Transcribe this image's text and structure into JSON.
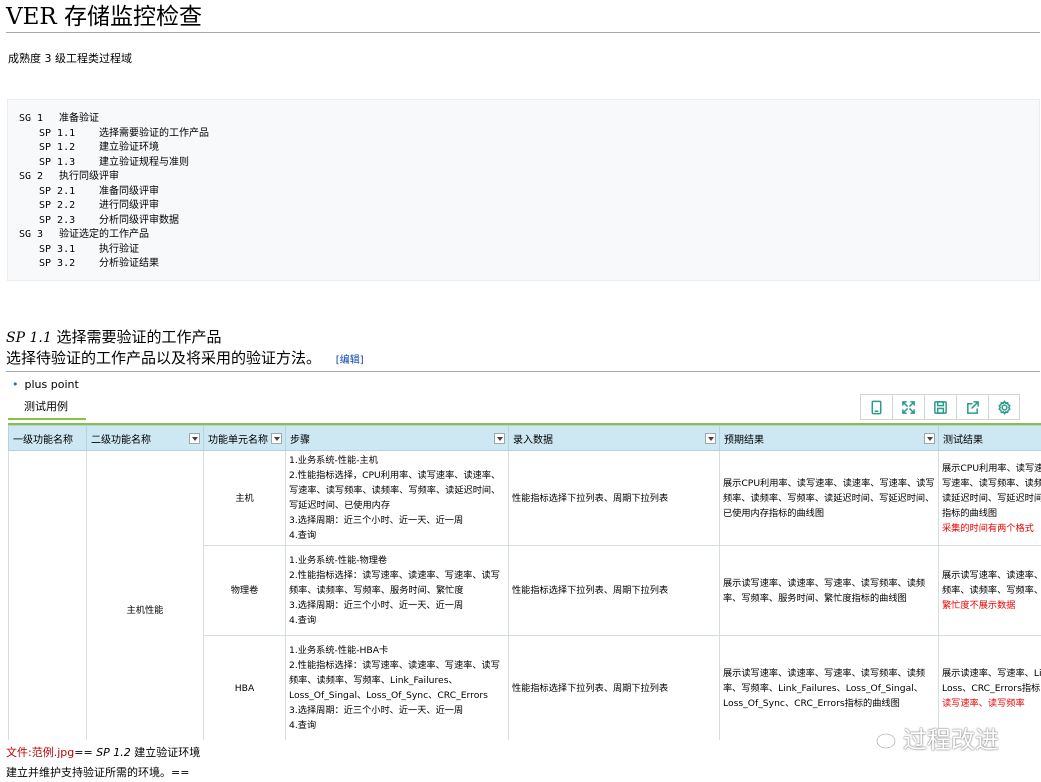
{
  "page": {
    "title": "VER 存储监控检查",
    "subtitle": "成熟度 3 级工程类过程域"
  },
  "outline": [
    {
      "kind": "sg",
      "code": "SG 1",
      "text": "准备验证"
    },
    {
      "kind": "sp",
      "code": "SP 1.1",
      "text": "选择需要验证的工作产品"
    },
    {
      "kind": "sp",
      "code": "SP 1.2",
      "text": "建立验证环境"
    },
    {
      "kind": "sp",
      "code": "SP 1.3",
      "text": "建立验证规程与准则"
    },
    {
      "kind": "sg",
      "code": "SG 2",
      "text": "执行同级评审"
    },
    {
      "kind": "sp",
      "code": "SP 2.1",
      "text": "准备同级评审"
    },
    {
      "kind": "sp",
      "code": "SP 2.2",
      "text": "进行同级评审"
    },
    {
      "kind": "sp",
      "code": "SP 2.3",
      "text": "分析同级评审数据"
    },
    {
      "kind": "sg",
      "code": "SG 3",
      "text": "验证选定的工作产品"
    },
    {
      "kind": "sp",
      "code": "SP 3.1",
      "text": "执行验证"
    },
    {
      "kind": "sp",
      "code": "SP 3.2",
      "text": "分析验证结果"
    }
  ],
  "section": {
    "sp_code": "SP 1.1",
    "sp_title": "选择需要验证的工作产品",
    "description": "选择待验证的工作产品以及将采用的验证方法。",
    "edit_label": "[编辑]"
  },
  "bullet": "plus point",
  "tab_label": "测试用例",
  "toolbar": [
    {
      "icon": "tablet-icon"
    },
    {
      "icon": "expand-icon"
    },
    {
      "icon": "save-icon"
    },
    {
      "icon": "share-icon"
    },
    {
      "icon": "gear-icon"
    }
  ],
  "table": {
    "headers": [
      "一级功能名称",
      "二级功能名称",
      "功能单元名称",
      "步骤",
      "录入数据",
      "预期结果",
      "测试结果"
    ],
    "group2": "主机性能",
    "rows": [
      {
        "unit": "主机",
        "steps": "1.业务系统-性能-主机\n2.性能指标选择，CPU利用率、读写速率、读速率、写速率、读写频率、读频率、写频率、读延迟时间、写延迟时间、已使用内存\n3.选择周期：近三个小时、近一天、近一周\n4.查询",
        "input": "性能指标选择下拉列表、周期下拉列表",
        "expected": "展示CPU利用率、读写速率、读速率、写速率、读写频率、读频率、写频率、读延迟时间、写延迟时间、已使用内存指标的曲线图",
        "result": "展示CPU利用率、读写速率、读速率、写速率、读写频率、读频率、写频率、读延迟时间、写延迟时间、已使用内存指标的曲线图",
        "result_note": "采集的时间有两个格式"
      },
      {
        "unit": "物理卷",
        "steps": "1.业务系统-性能-物理卷\n2.性能指标选择：读写速率、读速率、写速率、读写频率、读频率、写频率、服务时间、繁忙度\n3.选择周期：近三个小时、近一天、近一周\n4.查询",
        "input": "性能指标选择下拉列表、周期下拉列表",
        "expected": "展示读写速率、读速率、写速率、读写频率、读频率、写频率、服务时间、繁忙度指标的曲线图",
        "result": "展示读写速率、读速率、写速率、读写频率、读频率、写频率、服务时间",
        "result_note": "繁忙度不展示数据"
      },
      {
        "unit": "HBA",
        "steps": "1.业务系统-性能-HBA卡\n2.性能指标选择：读写速率、读速率、写速率、读写频率、读频率、写频率、Link_Failures、Loss_Of_Singal、Loss_Of_Sync、CRC_Errors\n3.选择周期：近三个小时、近一天、近一周\n4.查询",
        "input": "性能指标选择下拉列表、周期下拉列表",
        "expected": "展示读写速率、读速率、写速率、读写频率、读频率、写频率、Link_Failures、Loss_Of_Singal、Loss_Of_Sync、CRC_Errors指标的曲线图",
        "result": "展示读速率、写速率、Link_Failures、Loss、CRC_Errors指标",
        "result_note": "读写速率、读写频率"
      }
    ]
  },
  "footer": {
    "file_link": "文件:范例.jpg",
    "eq1": "== ",
    "sp_code": "SP 1.2",
    "sp_title": " 建立验证环境",
    "line2": "建立并维护支持验证所需的环境。=="
  },
  "watermark": "过程改进"
}
